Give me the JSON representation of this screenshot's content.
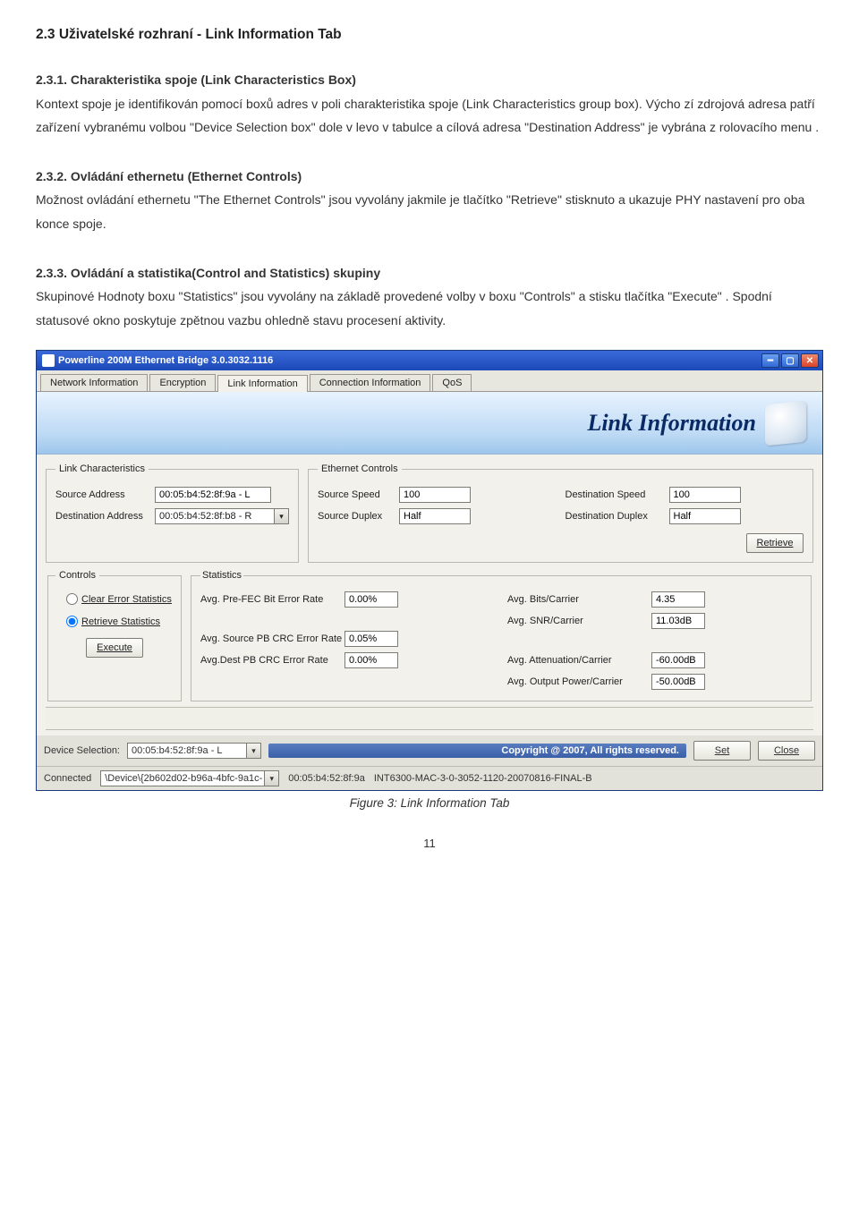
{
  "doc": {
    "h23": "2.3 Uživatelské rozhraní - Link Information Tab",
    "h231": "2.3.1. Charakteristika spoje (Link Characteristics Box)",
    "p231": "Kontext spoje je identifikován pomocí boxů adres v poli charakteristika spoje (Link Characteristics group box). Výcho zí zdrojová adresa patří zařízení vybranému volbou \"Device Selection box\" dole v levo v tabulce a cílová adresa \"Destination Address\" je vybrána z rolovacího menu .",
    "h232": "2.3.2. Ovládání ethernetu (Ethernet Controls)",
    "p232": "Možnost ovládání ethernetu \"The Ethernet Controls\" jsou vyvolány jakmile je tlačítko \"Retrieve\" stisknuto a ukazuje PHY nastavení pro oba konce spoje.",
    "h233": "2.3.3. Ovládání a statistika(Control and Statistics) skupiny",
    "p233": "Skupinové Hodnoty boxu \"Statistics\" jsou vyvolány na základě provedené volby v boxu \"Controls\" a stisku tlačítka \"Execute\" . Spodní statusové okno poskytuje zpětnou vazbu ohledně stavu procesení aktivity.",
    "figcap": "Figure 3: Link Information Tab",
    "pagenum": "11"
  },
  "win": {
    "title": "Powerline 200M Ethernet Bridge 3.0.3032.1116",
    "tabs": {
      "net": "Network Information",
      "enc": "Encryption",
      "link": "Link Information",
      "conn": "Connection Information",
      "qos": "QoS"
    },
    "banner": "Link Information",
    "groups": {
      "linkchar": {
        "legend": "Link Characteristics",
        "src_lbl": "Source Address",
        "src_val": "00:05:b4:52:8f:9a - L",
        "dst_lbl": "Destination Address",
        "dst_val": "00:05:b4:52:8f:b8 - R"
      },
      "ethctl": {
        "legend": "Ethernet Controls",
        "srcspd_lbl": "Source Speed",
        "srcspd_val": "100",
        "srcdup_lbl": "Source Duplex",
        "srcdup_val": "Half",
        "dstspd_lbl": "Destination Speed",
        "dstspd_val": "100",
        "dstdup_lbl": "Destination Duplex",
        "dstdup_val": "Half",
        "retrieve_btn": "Retrieve"
      },
      "controls": {
        "legend": "Controls",
        "opt_clear": "Clear Error Statistics",
        "opt_retrieve": "Retrieve Statistics",
        "execute_btn": "Execute"
      },
      "stats": {
        "legend": "Statistics",
        "prefec_lbl": "Avg. Pre-FEC Bit Error Rate",
        "prefec_val": "0.00%",
        "srcpb_lbl": "Avg. Source PB CRC Error Rate",
        "srcpb_val": "0.05%",
        "dstpb_lbl": "Avg.Dest PB CRC Error Rate",
        "dstpb_val": "0.00%",
        "bits_lbl": "Avg. Bits/Carrier",
        "bits_val": "4.35",
        "snr_lbl": "Avg. SNR/Carrier",
        "snr_val": "11.03dB",
        "att_lbl": "Avg. Attenuation/Carrier",
        "att_val": "-60.00dB",
        "out_lbl": "Avg. Output Power/Carrier",
        "out_val": "-50.00dB"
      }
    },
    "footer": {
      "devsel_lbl": "Device Selection:",
      "devsel_val": "00:05:b4:52:8f:9a - L",
      "copyright": "Copyright @ 2007, All rights reserved.",
      "set_btn": "Set",
      "close_btn": "Close"
    },
    "statusbar": {
      "connected": "Connected",
      "devpath": "\\Device\\{2b602d02-b96a-4bfc-9a1c-",
      "mac": "00:05:b4:52:8f:9a",
      "fw": "INT6300-MAC-3-0-3052-1120-20070816-FINAL-B"
    }
  }
}
